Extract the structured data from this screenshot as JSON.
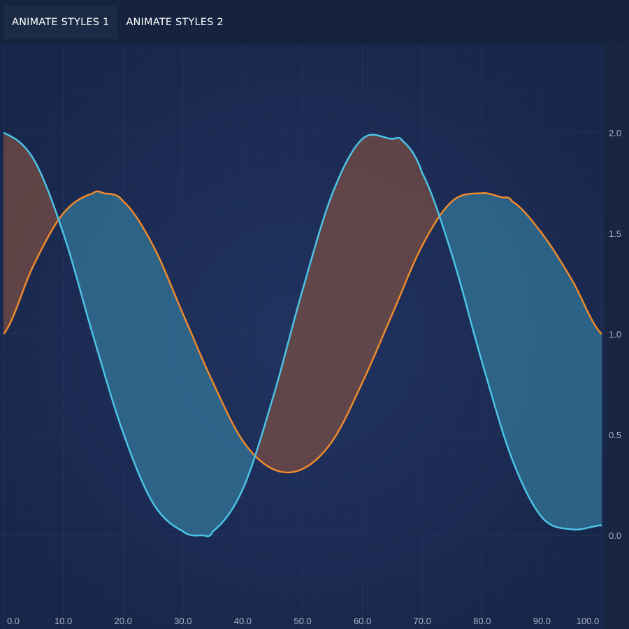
{
  "toolbar": {
    "buttons": [
      {
        "label": "ANIMATE STYLES 1",
        "active": true
      },
      {
        "label": "ANIMATE STYLES 2",
        "active": false
      }
    ]
  },
  "colors": {
    "background": "#172540",
    "series_a": "#4cc3e6",
    "series_b": "#ef8a2c",
    "fill_a_above": "#7a4d43",
    "fill_b_above": "#33789a",
    "grid": "#24355a"
  },
  "chart_data": {
    "type": "area",
    "title": "",
    "xlabel": "",
    "ylabel": "",
    "xlim": [
      0,
      100
    ],
    "ylim": [
      -0.3,
      2.4
    ],
    "x_ticks": [
      "0.0",
      "10.0",
      "20.0",
      "30.0",
      "40.0",
      "50.0",
      "60.0",
      "70.0",
      "80.0",
      "90.0",
      "100.0"
    ],
    "y_ticks": [
      "0.0",
      "0.5",
      "1.0",
      "1.5",
      "2.0"
    ],
    "band": "filled band between two series; fill color depends on which series is higher",
    "grid": true,
    "series": [
      {
        "x": [
          0,
          5,
          10,
          15,
          20,
          25,
          30,
          33.3,
          35,
          40,
          45,
          50,
          55,
          60,
          65,
          66.7,
          70,
          75,
          80,
          85,
          90,
          95,
          100
        ],
        "values": [
          2.0,
          1.87,
          1.5,
          0.99,
          0.51,
          0.16,
          0.02,
          0.0,
          0.02,
          0.23,
          0.68,
          1.22,
          1.7,
          1.97,
          1.97,
          1.96,
          1.8,
          1.39,
          0.86,
          0.38,
          0.09,
          0.03,
          0.05
        ]
      },
      {
        "x": [
          0,
          5,
          10,
          15,
          16.7,
          20,
          25,
          30,
          35,
          40,
          45,
          50,
          55,
          60,
          65,
          70,
          75,
          80,
          83.3,
          85,
          90,
          95,
          100
        ],
        "values": [
          1.0,
          1.34,
          1.6,
          1.7,
          1.7,
          1.66,
          1.44,
          1.1,
          0.76,
          0.47,
          0.33,
          0.33,
          0.47,
          0.76,
          1.1,
          1.44,
          1.66,
          1.7,
          1.68,
          1.66,
          1.5,
          1.27,
          1.0
        ]
      }
    ]
  }
}
